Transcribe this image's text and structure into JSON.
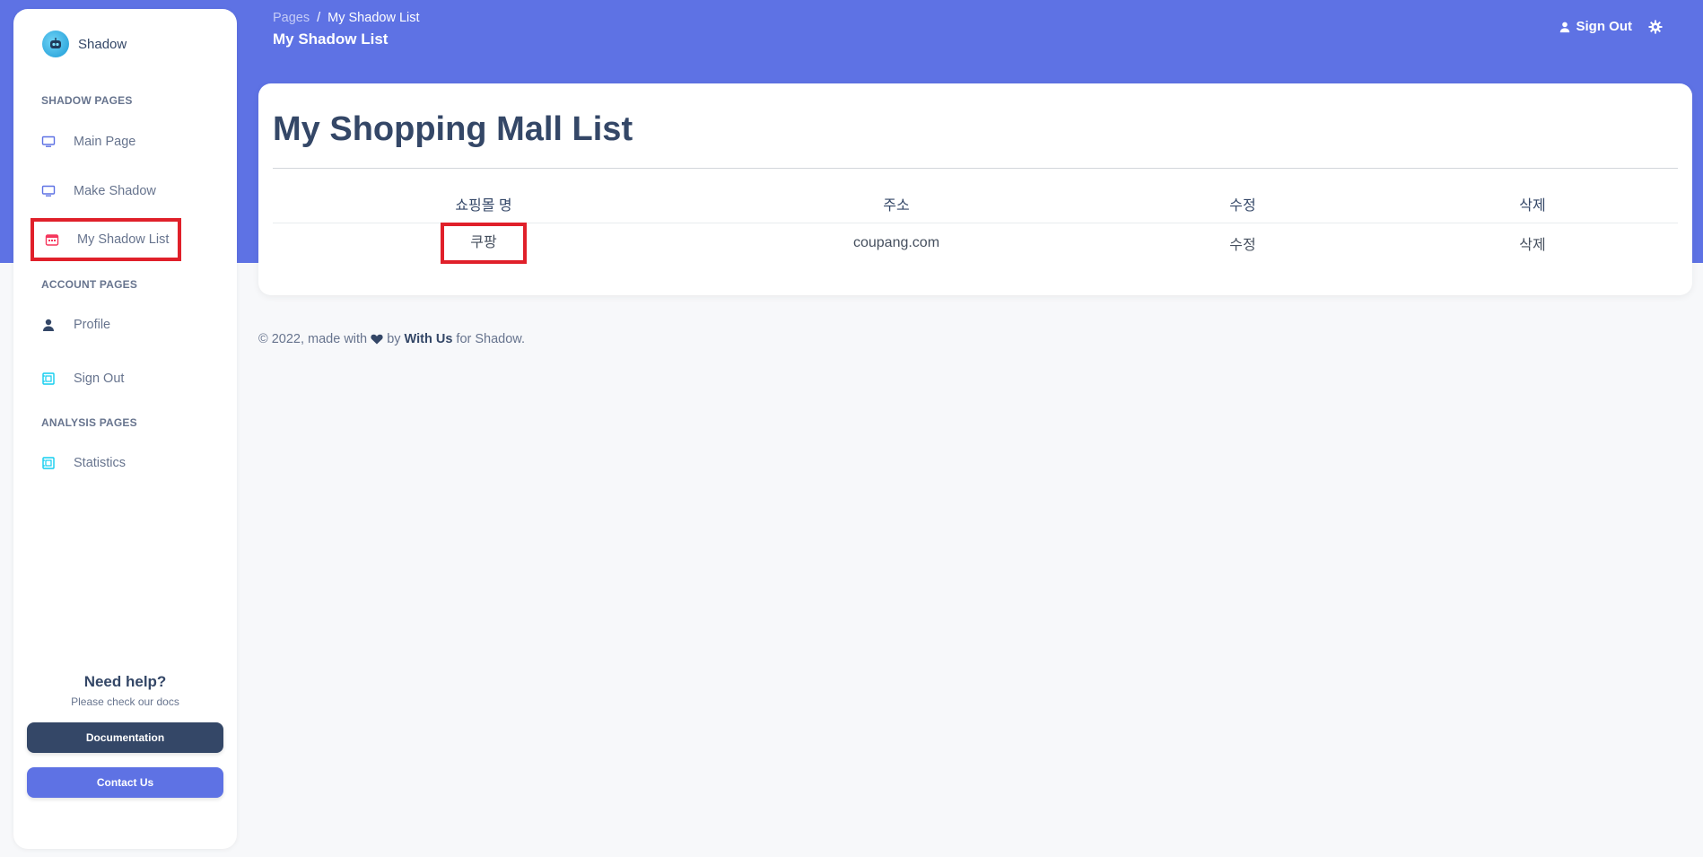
{
  "brand": {
    "name": "Shadow",
    "logo_icon": "robot-icon"
  },
  "sidebar": {
    "sections": [
      {
        "title": "SHADOW PAGES"
      },
      {
        "title": "ACCOUNT PAGES"
      },
      {
        "title": "ANALYSIS PAGES"
      }
    ],
    "items": [
      {
        "label": "Main Page",
        "icon": "monitor-icon"
      },
      {
        "label": "Make Shadow",
        "icon": "monitor-icon"
      },
      {
        "label": "My Shadow List",
        "icon": "calendar-icon",
        "active": true
      },
      {
        "label": "Profile",
        "icon": "user-icon"
      },
      {
        "label": "Sign Out",
        "icon": "document-icon"
      },
      {
        "label": "Statistics",
        "icon": "document-icon"
      }
    ],
    "help": {
      "title": "Need help?",
      "subtitle": "Please check our docs",
      "documentation_label": "Documentation",
      "contact_label": "Contact Us"
    }
  },
  "header": {
    "breadcrumb_root": "Pages",
    "breadcrumb_separator": "/",
    "breadcrumb_current": "My Shadow List",
    "title": "My Shadow List",
    "signout_label": "Sign Out"
  },
  "card": {
    "title": "My Shopping Mall List",
    "columns": [
      "쇼핑몰 명",
      "주소",
      "수정",
      "삭제"
    ],
    "rows": [
      {
        "name": "쿠팡",
        "address": "coupang.com",
        "edit": "수정",
        "delete": "삭제"
      }
    ]
  },
  "footer": {
    "prefix": "© 2022, made with",
    "by": "by",
    "link": "With Us",
    "suffix": "for Shadow."
  },
  "colors": {
    "accent": "#5e72e4",
    "dark": "#344767",
    "highlight": "#e0202a"
  }
}
